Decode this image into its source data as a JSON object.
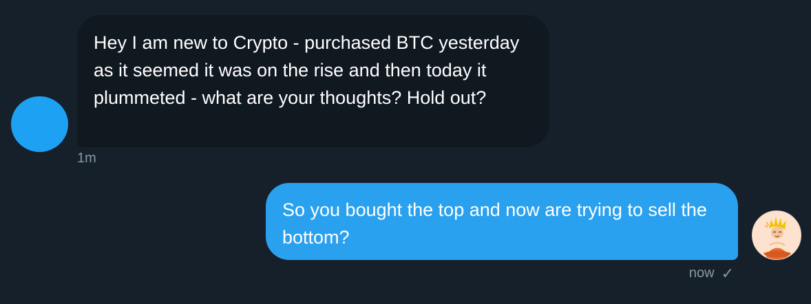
{
  "conversation": {
    "incoming": {
      "text": "Hey I am new to Crypto - purchased BTC yesterday as it seemed it was on the rise and then today it plummeted - what are your thoughts? Hold out?",
      "timestamp": "1m"
    },
    "outgoing": {
      "text": "So you bought the top and now are trying to sell the bottom?",
      "timestamp": "now",
      "status_icon": "check-icon"
    }
  },
  "colors": {
    "background": "#16202b",
    "incoming_bubble": "#101820",
    "outgoing_bubble": "#2aa1ef",
    "incoming_avatar": "#1da1f2",
    "meta_text": "#8899a6"
  }
}
